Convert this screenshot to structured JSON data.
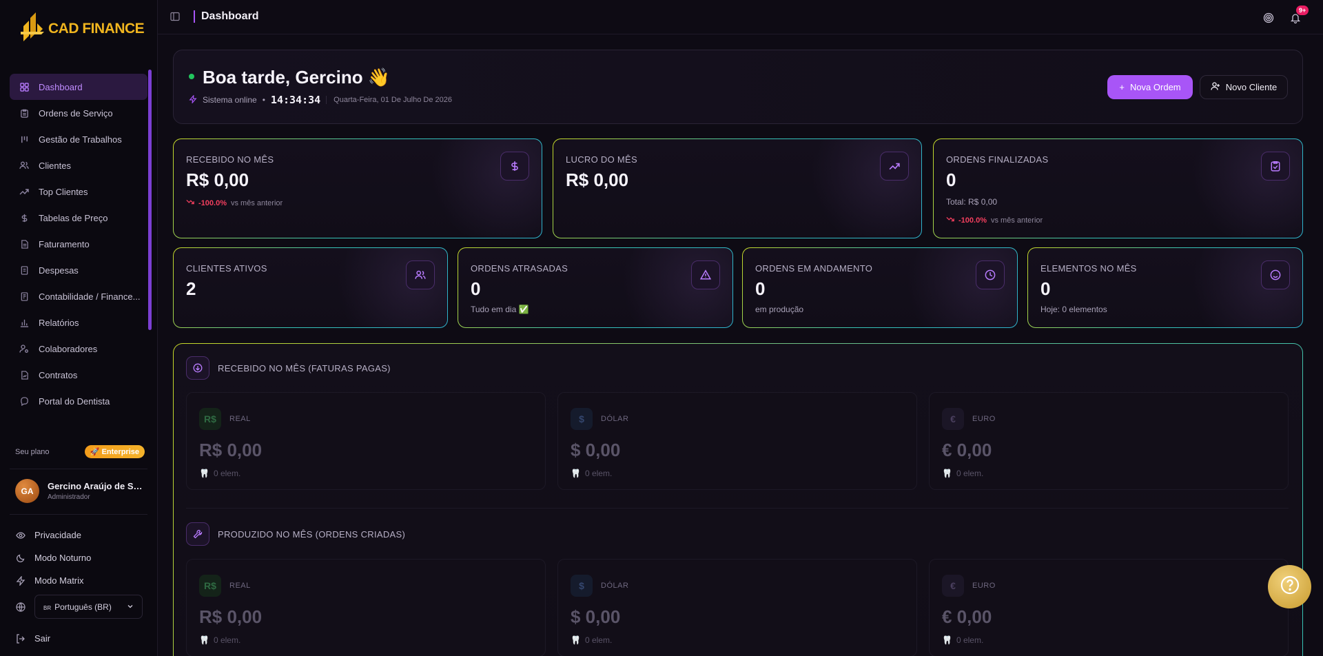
{
  "app": {
    "brand": "CAD FINANCE",
    "brand_color": "#f0b51f",
    "accent": "#a855f7"
  },
  "sidebar": {
    "items": [
      {
        "label": "Dashboard",
        "icon": "grid-icon",
        "active": true
      },
      {
        "label": "Ordens de Serviço",
        "icon": "clipboard-icon"
      },
      {
        "label": "Gestão de Trabalhos",
        "icon": "kanban-icon"
      },
      {
        "label": "Clientes",
        "icon": "users-icon"
      },
      {
        "label": "Top Clientes",
        "icon": "trending-up-icon"
      },
      {
        "label": "Tabelas de Preço",
        "icon": "dollar-icon"
      },
      {
        "label": "Faturamento",
        "icon": "file-text-icon"
      },
      {
        "label": "Despesas",
        "icon": "receipt-icon"
      },
      {
        "label": "Contabilidade / Finance...",
        "icon": "book-icon"
      },
      {
        "label": "Relatórios",
        "icon": "bar-chart-icon"
      },
      {
        "label": "Colaboradores",
        "icon": "user-cog-icon"
      },
      {
        "label": "Contratos",
        "icon": "file-signature-icon"
      },
      {
        "label": "Portal do Dentista",
        "icon": "external-icon"
      }
    ],
    "plan_label": "Seu plano",
    "plan_badge": "Enterprise",
    "user": {
      "initials": "GA",
      "name": "Gercino Araújo de Sou...",
      "role": "Administrador"
    },
    "links": [
      {
        "label": "Privacidade",
        "icon": "eye-icon"
      },
      {
        "label": "Modo Noturno",
        "icon": "moon-icon"
      },
      {
        "label": "Modo Matrix",
        "icon": "zap-icon"
      }
    ],
    "language": "Português (BR)",
    "language_flag": "BR",
    "logout": "Sair"
  },
  "topbar": {
    "breadcrumb": "Dashboard",
    "notif_count": "9+"
  },
  "hero": {
    "greeting": "Boa tarde, Gercino 👋",
    "status": "Sistema online",
    "clock": "14:34:34",
    "date": "Quarta-Feira, 01 De Julho De 2026",
    "btn_new_order": "Nova Ordem",
    "btn_new_client": "Novo Cliente"
  },
  "stats_row1": [
    {
      "label": "RECEBIDO NO MÊS",
      "value": "R$ 0,00",
      "trend": "-100.0%",
      "trend_suffix": "vs mês anterior",
      "icon": "dollar-icon"
    },
    {
      "label": "LUCRO DO MÊS",
      "value": "R$ 0,00",
      "icon": "trending-up-icon"
    },
    {
      "label": "ORDENS FINALIZADAS",
      "value": "0",
      "sub": "Total: R$ 0,00",
      "trend": "-100.0%",
      "trend_suffix": "vs mês anterior",
      "icon": "clipboard-check-icon"
    }
  ],
  "stats_row2": [
    {
      "label": "CLIENTES ATIVOS",
      "value": "2",
      "icon": "users-icon"
    },
    {
      "label": "ORDENS ATRASADAS",
      "value": "0",
      "sub": "Tudo em dia ✅",
      "icon": "alert-triangle-icon"
    },
    {
      "label": "ORDENS EM ANDAMENTO",
      "value": "0",
      "sub": "em produção",
      "icon": "clock-icon"
    },
    {
      "label": "ELEMENTOS NO MÊS",
      "value": "0",
      "sub": "Hoje: 0 elementos",
      "icon": "smile-icon"
    }
  ],
  "sections": [
    {
      "title": "RECEBIDO NO MÊS (FATURAS PAGAS)",
      "icon": "arrow-down-circle-icon",
      "currencies": [
        {
          "symbol": "R$",
          "name": "REAL",
          "amount": "R$ 0,00",
          "elements": "0 elem."
        },
        {
          "symbol": "$",
          "name": "DÓLAR",
          "amount": "$ 0,00",
          "elements": "0 elem."
        },
        {
          "symbol": "€",
          "name": "EURO",
          "amount": "€ 0,00",
          "elements": "0 elem."
        }
      ]
    },
    {
      "title": "PRODUZIDO NO MÊS (ORDENS CRIADAS)",
      "icon": "wrench-icon",
      "currencies": [
        {
          "symbol": "R$",
          "name": "REAL",
          "amount": "R$ 0,00",
          "elements": "0 elem."
        },
        {
          "symbol": "$",
          "name": "DÓLAR",
          "amount": "$ 0,00",
          "elements": "0 elem."
        },
        {
          "symbol": "€",
          "name": "EURO",
          "amount": "€ 0,00",
          "elements": "0 elem."
        }
      ]
    }
  ]
}
